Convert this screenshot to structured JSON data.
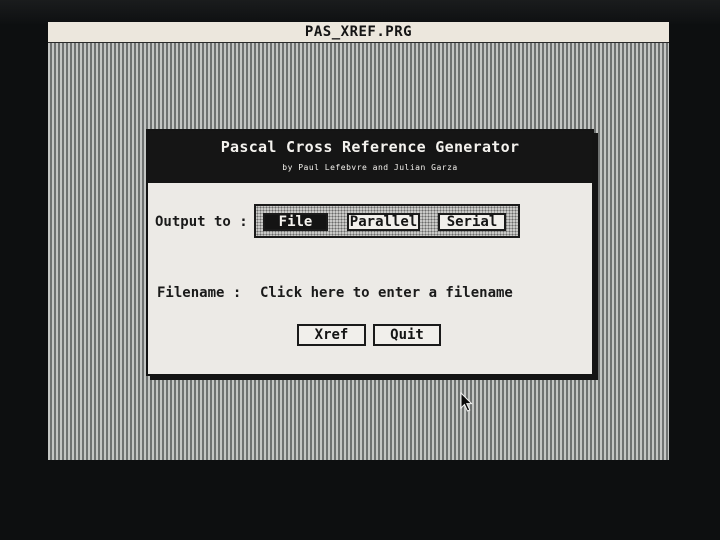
{
  "window": {
    "title": "PAS_XREF.PRG"
  },
  "dialog": {
    "title": "Pascal Cross Reference Generator",
    "credit": "by Paul Lefebvre and Julian Garza",
    "output_label": "Output to :",
    "output_options": [
      {
        "label": "File",
        "selected": true
      },
      {
        "label": "Parallel",
        "selected": false
      },
      {
        "label": "Serial",
        "selected": false
      }
    ],
    "filename_label": "Filename :",
    "filename_value": "Click here to enter a filename",
    "buttons": {
      "xref": "Xref",
      "quit": "Quit"
    }
  },
  "cursor": {
    "icon": "arrow-pointer-icon"
  },
  "colors": {
    "header_bg": "#151515",
    "dialog_bg": "#eceae6",
    "menu_bar_bg": "#ece7dd",
    "desktop_pattern": "#8e9190"
  }
}
